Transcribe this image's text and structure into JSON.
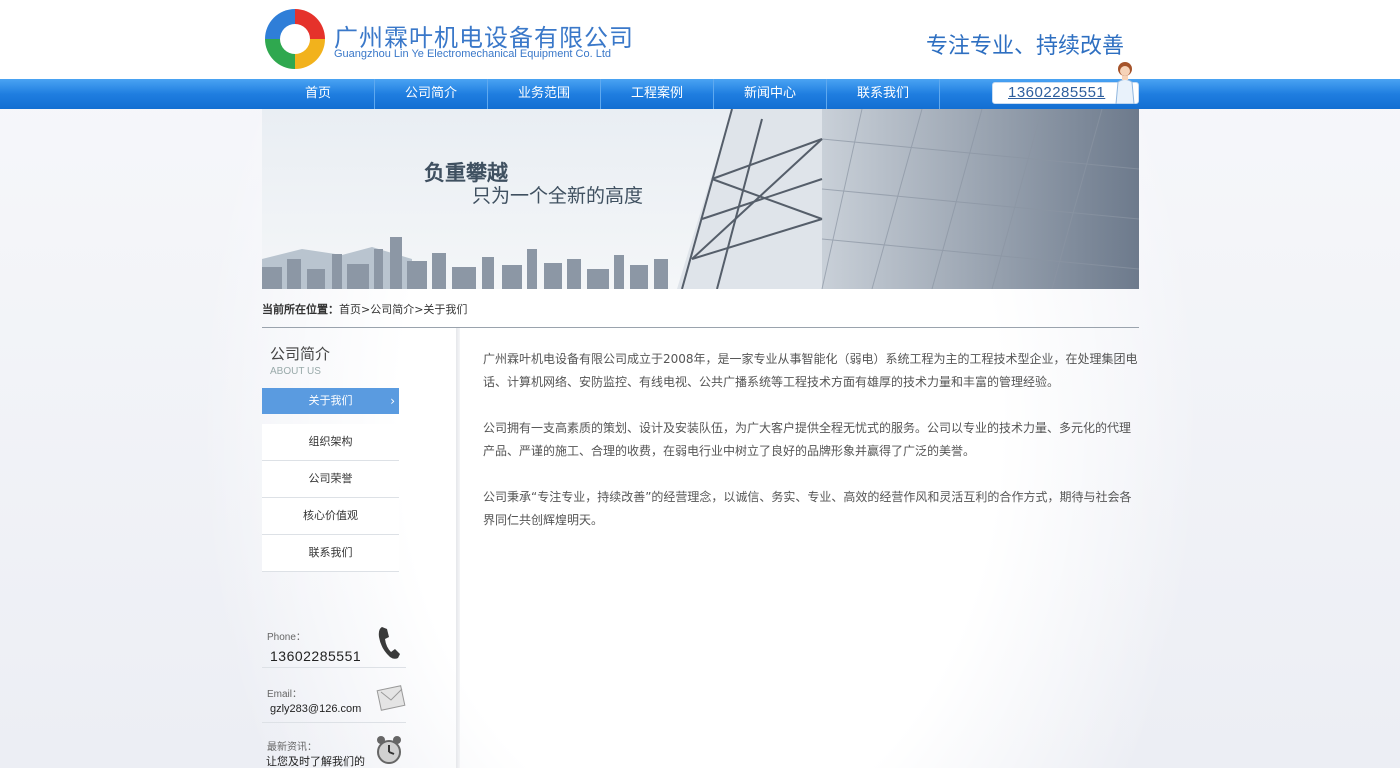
{
  "header": {
    "company_cn": "广州霖叶机电设备有限公司",
    "company_en": "Guangzhou Lin Ye Electromechanical Equipment Co. Ltd",
    "slogan": "专注专业、持续改善"
  },
  "nav": {
    "items": [
      "首页",
      "公司简介",
      "业务范围",
      "工程案例",
      "新闻中心",
      "联系我们"
    ],
    "phone": "13602285551"
  },
  "banner": {
    "line1": "负重攀越",
    "line2": "只为一个全新的高度"
  },
  "breadcrumb": {
    "lead": "当前所在位置：",
    "items": [
      "首页",
      ">公司简介",
      ">关于我们"
    ]
  },
  "sidebar": {
    "title": "公司简介",
    "subtitle": "ABOUT US",
    "items": [
      "关于我们",
      "组织架构",
      "公司荣誉",
      "核心价值观",
      "联系我们"
    ],
    "active_chevron": "›",
    "phone_label": "Phone：",
    "phone_value": "13602285551",
    "email_label": "Email：",
    "email_value": "gzly283@126.com",
    "news_label": "最新资讯：",
    "news_value": "让您及时了解我们的"
  },
  "content": {
    "paragraphs": [
      "广州霖叶机电设备有限公司成立于2008年，是一家专业从事智能化（弱电）系统工程为主的工程技术型企业，在处理集团电话、计算机网络、安防监控、有线电视、公共广播系统等工程技术方面有雄厚的技术力量和丰富的管理经验。",
      "公司拥有一支高素质的策划、设计及安装队伍，为广大客户提供全程无忧式的服务。公司以专业的技术力量、多元化的代理产品、严谨的施工、合理的收费，在弱电行业中树立了良好的品牌形象并赢得了广泛的美誉。",
      "公司秉承“专注专业，持续改善”的经营理念，以诚信、务实、专业、高效的经营作风和灵活互利的合作方式，期待与社会各界同仁共创辉煌明天。"
    ]
  },
  "colors": {
    "nav_blue": "#1f7ee0",
    "brand_blue": "#3a78c9",
    "active_side": "#5a9be0"
  }
}
